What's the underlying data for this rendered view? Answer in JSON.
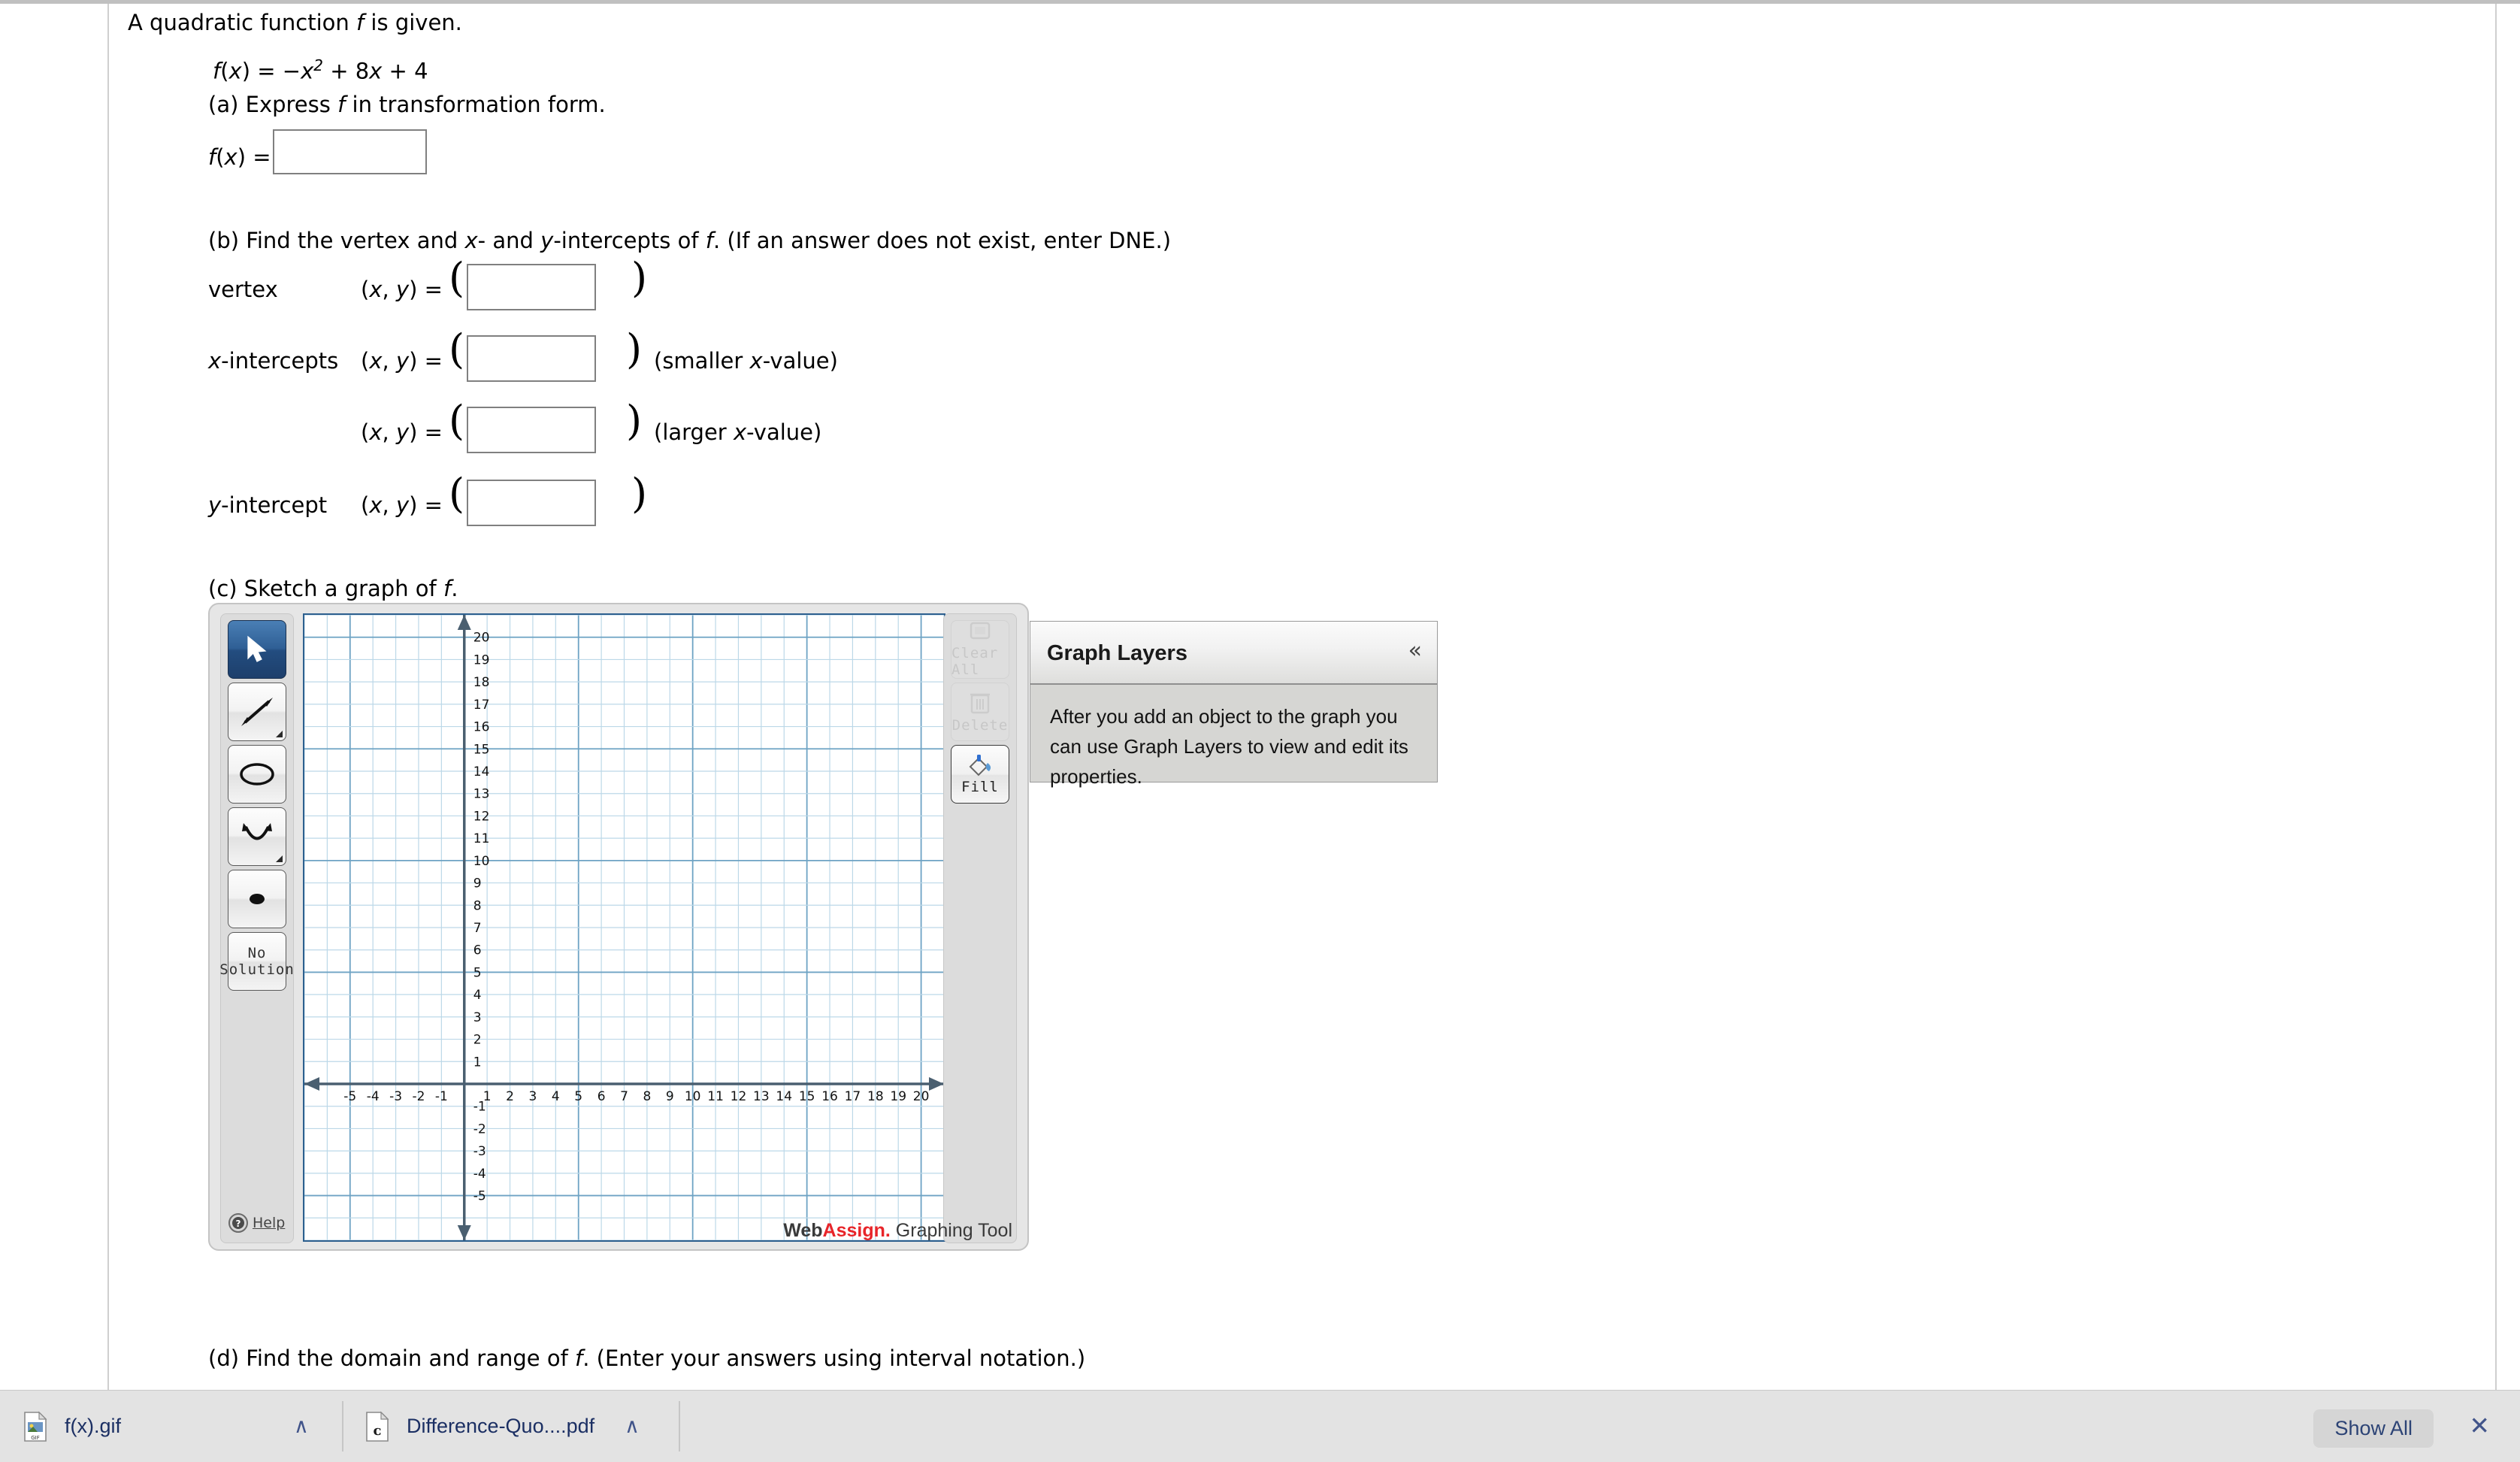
{
  "problem": {
    "intro": "A quadratic function f is given.",
    "intro_italic_var": "f",
    "formula_lhs": "f(x)",
    "formula_eq": "=",
    "formula_rhs_a": "−x",
    "formula_rhs_exp": "2",
    "formula_rhs_b": "+ 8x + 4",
    "part_a": "(a) Express f in transformation form.",
    "part_a_label": "f(x) =",
    "part_a_value": "",
    "part_a_placeholder": "",
    "part_b": "(b) Find the vertex and x- and y-intercepts of f. (If an answer does not exist, enter DNE.)",
    "part_c": "(c) Sketch a graph of f.",
    "part_d": "(d) Find the domain and range of f. (Enter your answers using interval notation.)",
    "rows": [
      {
        "label": "vertex",
        "coord": "(x, y) =",
        "value": "",
        "note": ""
      },
      {
        "label": "x-intercepts",
        "coord": "(x, y) =",
        "value": "",
        "note": "(smaller x-value)"
      },
      {
        "label": "",
        "coord": "(x, y) =",
        "value": "",
        "note": "(larger x-value)"
      },
      {
        "label": "y-intercept",
        "coord": "(x, y) =",
        "value": "",
        "note": ""
      }
    ],
    "paren_open": "(",
    "paren_close": ")"
  },
  "graph_tool": {
    "tools": [
      {
        "name": "pointer",
        "label": "",
        "selected": true,
        "submenu": false
      },
      {
        "name": "line",
        "label": "",
        "selected": false,
        "submenu": true
      },
      {
        "name": "circle",
        "label": "",
        "selected": false,
        "submenu": false
      },
      {
        "name": "parabola",
        "label": "",
        "selected": false,
        "submenu": true
      },
      {
        "name": "point",
        "label": "",
        "selected": false,
        "submenu": false
      },
      {
        "name": "no-solution",
        "label": "No Solution",
        "selected": false,
        "submenu": false
      }
    ],
    "help_label": "Help",
    "actions": [
      {
        "name": "clear-all",
        "label": "Clear All",
        "enabled": false
      },
      {
        "name": "delete",
        "label": "Delete",
        "enabled": false
      },
      {
        "name": "fill",
        "label": "Fill",
        "enabled": true
      }
    ],
    "footer_web": "Web",
    "footer_assign": "Assign.",
    "footer_tool": "Graphing Tool",
    "accent_red": "#e8252a",
    "grid_minor_color": "#bcd8e8",
    "grid_major_color": "#6ea3c4",
    "axis_color": "#4a5f70"
  },
  "layers_panel": {
    "title": "Graph Layers",
    "collapse_icon": "«",
    "body": "After you add an object to the graph you can use Graph Layers to view and edit its properties."
  },
  "chart_data": {
    "type": "scatter",
    "title": "",
    "xlabel": "",
    "ylabel": "",
    "xlim": [
      -7,
      21
    ],
    "ylim": [
      -7,
      21
    ],
    "x_ticks": [
      -5,
      -4,
      -3,
      -2,
      -1,
      1,
      2,
      3,
      4,
      5,
      6,
      7,
      8,
      9,
      10,
      11,
      12,
      13,
      14,
      15,
      16,
      17,
      18,
      19,
      20
    ],
    "y_ticks": [
      -5,
      -4,
      -3,
      -2,
      -1,
      1,
      2,
      3,
      4,
      5,
      6,
      7,
      8,
      9,
      10,
      11,
      12,
      13,
      14,
      15,
      16,
      17,
      18,
      19,
      20
    ],
    "grid": true,
    "minor_step": 1,
    "major_step": 5,
    "series": [],
    "legend": null
  },
  "download_bar": {
    "items": [
      {
        "name": "f(x).gif",
        "icon": "gif-file-icon",
        "caret": "∧"
      },
      {
        "name": "Difference-Quo....pdf",
        "icon": "pdf-file-icon",
        "caret": "∧"
      }
    ],
    "show_all_label": "Show All",
    "close_icon": "✕"
  }
}
